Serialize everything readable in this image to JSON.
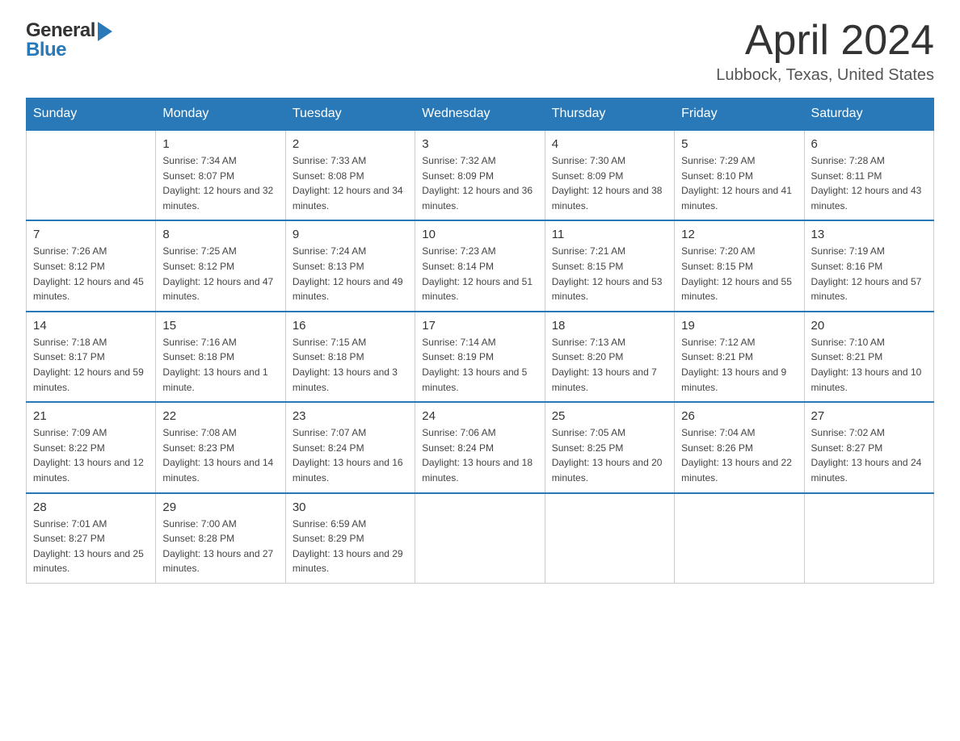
{
  "header": {
    "month_year": "April 2024",
    "location": "Lubbock, Texas, United States",
    "logo_general": "General",
    "logo_blue": "Blue"
  },
  "weekdays": [
    "Sunday",
    "Monday",
    "Tuesday",
    "Wednesday",
    "Thursday",
    "Friday",
    "Saturday"
  ],
  "weeks": [
    [
      {
        "day": "",
        "sunrise": "",
        "sunset": "",
        "daylight": ""
      },
      {
        "day": "1",
        "sunrise": "Sunrise: 7:34 AM",
        "sunset": "Sunset: 8:07 PM",
        "daylight": "Daylight: 12 hours and 32 minutes."
      },
      {
        "day": "2",
        "sunrise": "Sunrise: 7:33 AM",
        "sunset": "Sunset: 8:08 PM",
        "daylight": "Daylight: 12 hours and 34 minutes."
      },
      {
        "day": "3",
        "sunrise": "Sunrise: 7:32 AM",
        "sunset": "Sunset: 8:09 PM",
        "daylight": "Daylight: 12 hours and 36 minutes."
      },
      {
        "day": "4",
        "sunrise": "Sunrise: 7:30 AM",
        "sunset": "Sunset: 8:09 PM",
        "daylight": "Daylight: 12 hours and 38 minutes."
      },
      {
        "day": "5",
        "sunrise": "Sunrise: 7:29 AM",
        "sunset": "Sunset: 8:10 PM",
        "daylight": "Daylight: 12 hours and 41 minutes."
      },
      {
        "day": "6",
        "sunrise": "Sunrise: 7:28 AM",
        "sunset": "Sunset: 8:11 PM",
        "daylight": "Daylight: 12 hours and 43 minutes."
      }
    ],
    [
      {
        "day": "7",
        "sunrise": "Sunrise: 7:26 AM",
        "sunset": "Sunset: 8:12 PM",
        "daylight": "Daylight: 12 hours and 45 minutes."
      },
      {
        "day": "8",
        "sunrise": "Sunrise: 7:25 AM",
        "sunset": "Sunset: 8:12 PM",
        "daylight": "Daylight: 12 hours and 47 minutes."
      },
      {
        "day": "9",
        "sunrise": "Sunrise: 7:24 AM",
        "sunset": "Sunset: 8:13 PM",
        "daylight": "Daylight: 12 hours and 49 minutes."
      },
      {
        "day": "10",
        "sunrise": "Sunrise: 7:23 AM",
        "sunset": "Sunset: 8:14 PM",
        "daylight": "Daylight: 12 hours and 51 minutes."
      },
      {
        "day": "11",
        "sunrise": "Sunrise: 7:21 AM",
        "sunset": "Sunset: 8:15 PM",
        "daylight": "Daylight: 12 hours and 53 minutes."
      },
      {
        "day": "12",
        "sunrise": "Sunrise: 7:20 AM",
        "sunset": "Sunset: 8:15 PM",
        "daylight": "Daylight: 12 hours and 55 minutes."
      },
      {
        "day": "13",
        "sunrise": "Sunrise: 7:19 AM",
        "sunset": "Sunset: 8:16 PM",
        "daylight": "Daylight: 12 hours and 57 minutes."
      }
    ],
    [
      {
        "day": "14",
        "sunrise": "Sunrise: 7:18 AM",
        "sunset": "Sunset: 8:17 PM",
        "daylight": "Daylight: 12 hours and 59 minutes."
      },
      {
        "day": "15",
        "sunrise": "Sunrise: 7:16 AM",
        "sunset": "Sunset: 8:18 PM",
        "daylight": "Daylight: 13 hours and 1 minute."
      },
      {
        "day": "16",
        "sunrise": "Sunrise: 7:15 AM",
        "sunset": "Sunset: 8:18 PM",
        "daylight": "Daylight: 13 hours and 3 minutes."
      },
      {
        "day": "17",
        "sunrise": "Sunrise: 7:14 AM",
        "sunset": "Sunset: 8:19 PM",
        "daylight": "Daylight: 13 hours and 5 minutes."
      },
      {
        "day": "18",
        "sunrise": "Sunrise: 7:13 AM",
        "sunset": "Sunset: 8:20 PM",
        "daylight": "Daylight: 13 hours and 7 minutes."
      },
      {
        "day": "19",
        "sunrise": "Sunrise: 7:12 AM",
        "sunset": "Sunset: 8:21 PM",
        "daylight": "Daylight: 13 hours and 9 minutes."
      },
      {
        "day": "20",
        "sunrise": "Sunrise: 7:10 AM",
        "sunset": "Sunset: 8:21 PM",
        "daylight": "Daylight: 13 hours and 10 minutes."
      }
    ],
    [
      {
        "day": "21",
        "sunrise": "Sunrise: 7:09 AM",
        "sunset": "Sunset: 8:22 PM",
        "daylight": "Daylight: 13 hours and 12 minutes."
      },
      {
        "day": "22",
        "sunrise": "Sunrise: 7:08 AM",
        "sunset": "Sunset: 8:23 PM",
        "daylight": "Daylight: 13 hours and 14 minutes."
      },
      {
        "day": "23",
        "sunrise": "Sunrise: 7:07 AM",
        "sunset": "Sunset: 8:24 PM",
        "daylight": "Daylight: 13 hours and 16 minutes."
      },
      {
        "day": "24",
        "sunrise": "Sunrise: 7:06 AM",
        "sunset": "Sunset: 8:24 PM",
        "daylight": "Daylight: 13 hours and 18 minutes."
      },
      {
        "day": "25",
        "sunrise": "Sunrise: 7:05 AM",
        "sunset": "Sunset: 8:25 PM",
        "daylight": "Daylight: 13 hours and 20 minutes."
      },
      {
        "day": "26",
        "sunrise": "Sunrise: 7:04 AM",
        "sunset": "Sunset: 8:26 PM",
        "daylight": "Daylight: 13 hours and 22 minutes."
      },
      {
        "day": "27",
        "sunrise": "Sunrise: 7:02 AM",
        "sunset": "Sunset: 8:27 PM",
        "daylight": "Daylight: 13 hours and 24 minutes."
      }
    ],
    [
      {
        "day": "28",
        "sunrise": "Sunrise: 7:01 AM",
        "sunset": "Sunset: 8:27 PM",
        "daylight": "Daylight: 13 hours and 25 minutes."
      },
      {
        "day": "29",
        "sunrise": "Sunrise: 7:00 AM",
        "sunset": "Sunset: 8:28 PM",
        "daylight": "Daylight: 13 hours and 27 minutes."
      },
      {
        "day": "30",
        "sunrise": "Sunrise: 6:59 AM",
        "sunset": "Sunset: 8:29 PM",
        "daylight": "Daylight: 13 hours and 29 minutes."
      },
      {
        "day": "",
        "sunrise": "",
        "sunset": "",
        "daylight": ""
      },
      {
        "day": "",
        "sunrise": "",
        "sunset": "",
        "daylight": ""
      },
      {
        "day": "",
        "sunrise": "",
        "sunset": "",
        "daylight": ""
      },
      {
        "day": "",
        "sunrise": "",
        "sunset": "",
        "daylight": ""
      }
    ]
  ]
}
